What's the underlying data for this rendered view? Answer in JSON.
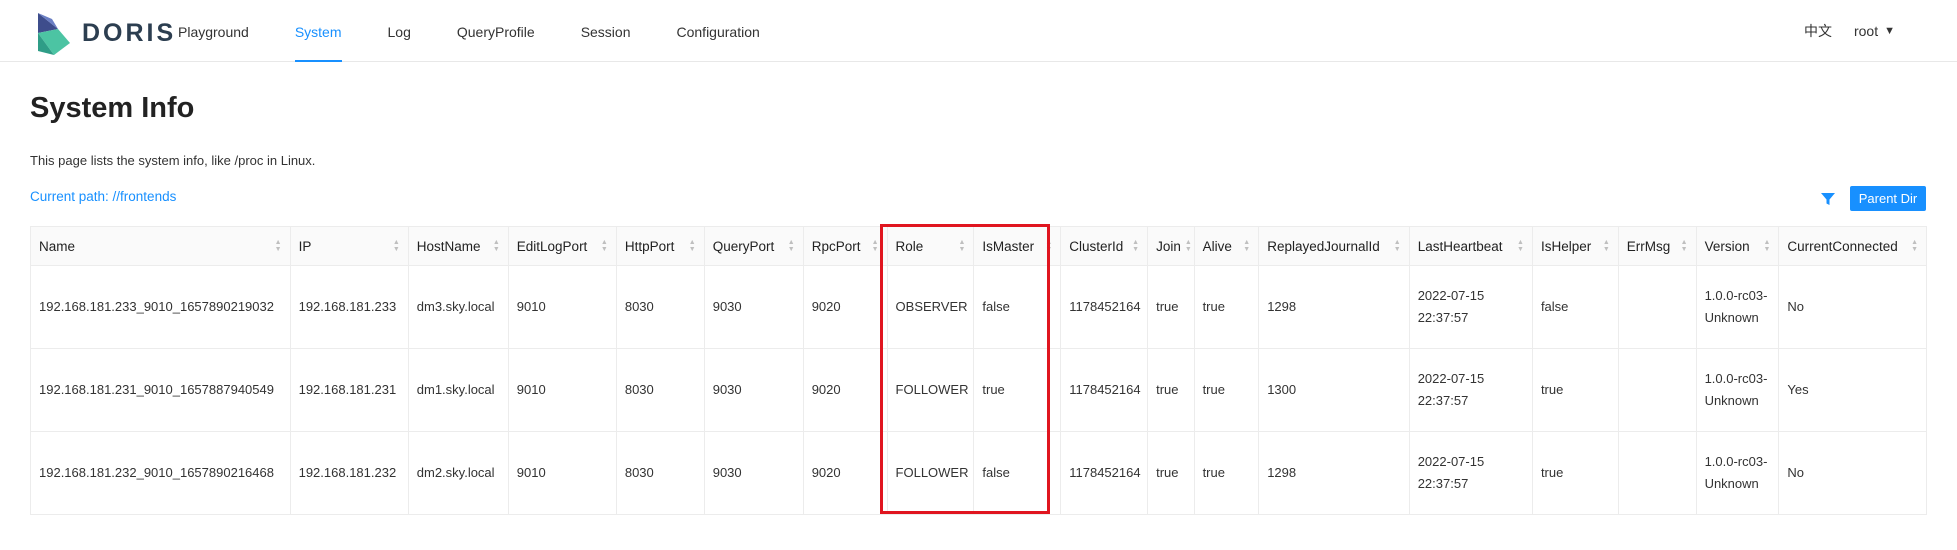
{
  "header": {
    "logo_text": "DORIS",
    "nav": [
      "Playground",
      "System",
      "Log",
      "QueryProfile",
      "Session",
      "Configuration"
    ],
    "active_nav": "System",
    "lang": "中文",
    "user": "root"
  },
  "page": {
    "title": "System Info",
    "description": "This page lists the system info, like /proc in Linux.",
    "current_path": "Current path: //frontends",
    "parent_dir_button": "Parent Dir"
  },
  "table": {
    "columns": [
      "Name",
      "IP",
      "HostName",
      "EditLogPort",
      "HttpPort",
      "QueryPort",
      "RpcPort",
      "Role",
      "IsMaster",
      "ClusterId",
      "Join",
      "Alive",
      "ReplayedJournalId",
      "LastHeartbeat",
      "IsHelper",
      "ErrMsg",
      "Version",
      "CurrentConnected"
    ],
    "rows": [
      [
        "192.168.181.233_9010_1657890219032",
        "192.168.181.233",
        "dm3.sky.local",
        "9010",
        "8030",
        "9030",
        "9020",
        "OBSERVER",
        "false",
        "1178452164",
        "true",
        "true",
        "1298",
        "2022-07-15 22:37:57",
        "false",
        "",
        "1.0.0-rc03-Unknown",
        "No"
      ],
      [
        "192.168.181.231_9010_1657887940549",
        "192.168.181.231",
        "dm1.sky.local",
        "9010",
        "8030",
        "9030",
        "9020",
        "FOLLOWER",
        "true",
        "1178452164",
        "true",
        "true",
        "1300",
        "2022-07-15 22:37:57",
        "true",
        "",
        "1.0.0-rc03-Unknown",
        "Yes"
      ],
      [
        "192.168.181.232_9010_1657890216468",
        "192.168.181.232",
        "dm2.sky.local",
        "9010",
        "8030",
        "9030",
        "9020",
        "FOLLOWER",
        "false",
        "1178452164",
        "true",
        "true",
        "1298",
        "2022-07-15 22:37:57",
        "true",
        "",
        "1.0.0-rc03-Unknown",
        "No"
      ]
    ]
  },
  "colors": {
    "accent": "#1890ff",
    "highlight": "#e0151f"
  }
}
